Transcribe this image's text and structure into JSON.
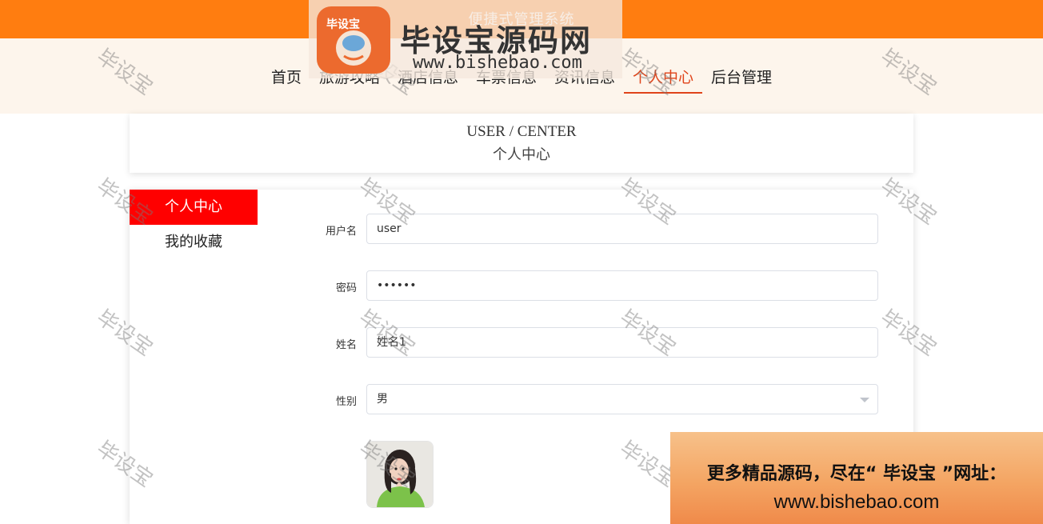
{
  "header": {
    "site_title": "便捷式管理系统",
    "nav": [
      {
        "label": "首页"
      },
      {
        "label": "旅游攻略"
      },
      {
        "label": "酒店信息"
      },
      {
        "label": "车票信息"
      },
      {
        "label": "资讯信息"
      },
      {
        "label": "个人中心",
        "active": true
      },
      {
        "label": "后台管理"
      }
    ]
  },
  "page_header": {
    "en": "USER / CENTER",
    "cn": "个人中心"
  },
  "sidebar": {
    "items": [
      {
        "label": "个人中心",
        "active": true
      },
      {
        "label": "我的收藏"
      }
    ]
  },
  "form": {
    "username": {
      "label": "用户名",
      "value": "user"
    },
    "password": {
      "label": "密码",
      "value": "••••••"
    },
    "name": {
      "label": "姓名",
      "value": "姓名1"
    },
    "gender": {
      "label": "性别",
      "value": "男"
    }
  },
  "watermark": {
    "text": "毕设宝",
    "logo_badge": "毕设宝",
    "logo_title": "毕设宝源码网",
    "logo_url": "www.bishebao.com"
  },
  "promo": {
    "line1": "更多精品源码，尽在“ 毕设宝 ”网址：",
    "line2": "www.bishebao.com"
  },
  "colors": {
    "topbar": "#ff7d10",
    "nav_active": "#e0441a",
    "sidebar_active": "#ff0000"
  }
}
